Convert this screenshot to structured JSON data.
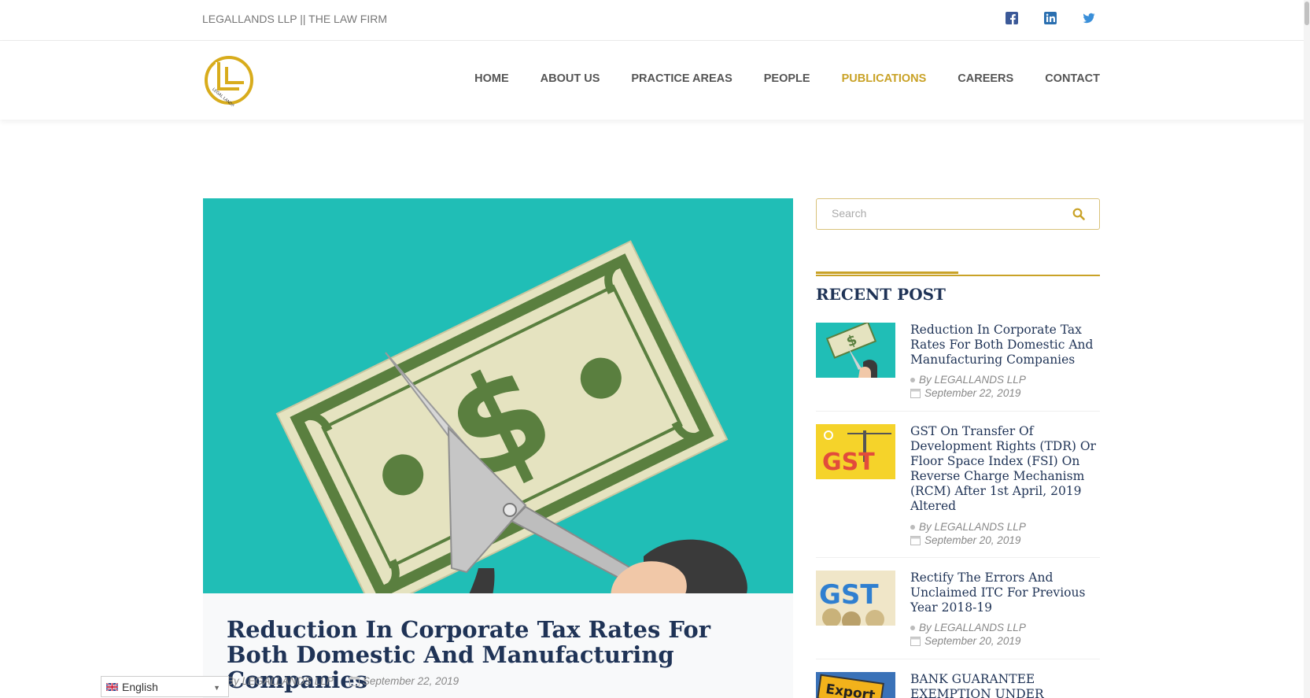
{
  "topbar": {
    "brand": "LEGALLANDS LLP || THE LAW FIRM",
    "social_icons": [
      "facebook-icon",
      "linkedin-icon",
      "twitter-icon"
    ]
  },
  "nav": {
    "items": [
      {
        "label": "HOME",
        "active": false
      },
      {
        "label": "ABOUT US",
        "active": false
      },
      {
        "label": "PRACTICE AREAS",
        "active": false
      },
      {
        "label": "PEOPLE",
        "active": false
      },
      {
        "label": "PUBLICATIONS",
        "active": true
      },
      {
        "label": "CAREERS",
        "active": false
      },
      {
        "label": "CONTACT",
        "active": false
      }
    ]
  },
  "logo": {
    "text": "LEGAL LANDS"
  },
  "post": {
    "title": "Reduction In Corporate Tax Rates For Both Domestic And Manufacturing Companies",
    "author": "By LEGALLANDS LLP",
    "date": "September 22, 2019"
  },
  "sidebar": {
    "search_placeholder": "Search",
    "recent_title": "RECENT POST",
    "recent_posts": [
      {
        "title": "Reduction In Corporate Tax Rates For Both Domestic And Manufacturing Companies",
        "author": "By LEGALLANDS LLP",
        "date": "September 22, 2019"
      },
      {
        "title": "GST On Transfer Of Development Rights (TDR) Or Floor Space Index (FSI) On Reverse Charge Mechanism (RCM) After 1st April, 2019 Altered",
        "author": "By LEGALLANDS LLP",
        "date": "September 20, 2019",
        "thumb_text": "GST"
      },
      {
        "title": "Rectify The Errors And Unclaimed ITC For Previous Year 2018-19",
        "author": "By LEGALLANDS LLP",
        "date": "September 20, 2019",
        "thumb_text": "GST"
      },
      {
        "title": "BANK GUARANTEE EXEMPTION UNDER",
        "thumb_text": "Export"
      }
    ]
  },
  "translate": {
    "label": "English"
  },
  "colors": {
    "accent": "#c9a227",
    "heading": "#1f3356",
    "hero_bg": "#20beb6"
  }
}
